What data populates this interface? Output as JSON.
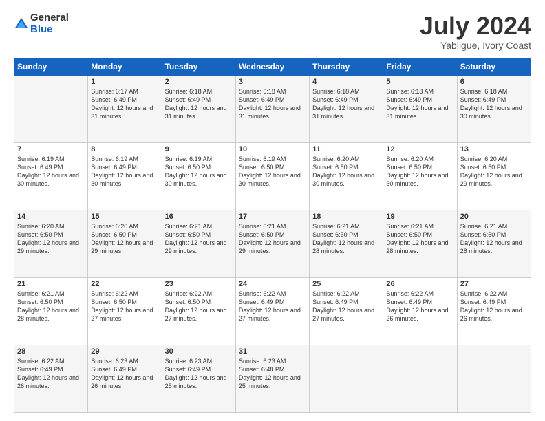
{
  "header": {
    "logo_general": "General",
    "logo_blue": "Blue",
    "title": "July 2024",
    "location": "Yabligue, Ivory Coast"
  },
  "calendar": {
    "days_of_week": [
      "Sunday",
      "Monday",
      "Tuesday",
      "Wednesday",
      "Thursday",
      "Friday",
      "Saturday"
    ],
    "weeks": [
      [
        {
          "day": "",
          "info": ""
        },
        {
          "day": "1",
          "info": "Sunrise: 6:17 AM\nSunset: 6:49 PM\nDaylight: 12 hours and 31 minutes."
        },
        {
          "day": "2",
          "info": "Sunrise: 6:18 AM\nSunset: 6:49 PM\nDaylight: 12 hours and 31 minutes."
        },
        {
          "day": "3",
          "info": "Sunrise: 6:18 AM\nSunset: 6:49 PM\nDaylight: 12 hours and 31 minutes."
        },
        {
          "day": "4",
          "info": "Sunrise: 6:18 AM\nSunset: 6:49 PM\nDaylight: 12 hours and 31 minutes."
        },
        {
          "day": "5",
          "info": "Sunrise: 6:18 AM\nSunset: 6:49 PM\nDaylight: 12 hours and 31 minutes."
        },
        {
          "day": "6",
          "info": "Sunrise: 6:18 AM\nSunset: 6:49 PM\nDaylight: 12 hours and 30 minutes."
        }
      ],
      [
        {
          "day": "7",
          "info": "Sunrise: 6:19 AM\nSunset: 6:49 PM\nDaylight: 12 hours and 30 minutes."
        },
        {
          "day": "8",
          "info": "Sunrise: 6:19 AM\nSunset: 6:49 PM\nDaylight: 12 hours and 30 minutes."
        },
        {
          "day": "9",
          "info": "Sunrise: 6:19 AM\nSunset: 6:50 PM\nDaylight: 12 hours and 30 minutes."
        },
        {
          "day": "10",
          "info": "Sunrise: 6:19 AM\nSunset: 6:50 PM\nDaylight: 12 hours and 30 minutes."
        },
        {
          "day": "11",
          "info": "Sunrise: 6:20 AM\nSunset: 6:50 PM\nDaylight: 12 hours and 30 minutes."
        },
        {
          "day": "12",
          "info": "Sunrise: 6:20 AM\nSunset: 6:50 PM\nDaylight: 12 hours and 30 minutes."
        },
        {
          "day": "13",
          "info": "Sunrise: 6:20 AM\nSunset: 6:50 PM\nDaylight: 12 hours and 29 minutes."
        }
      ],
      [
        {
          "day": "14",
          "info": "Sunrise: 6:20 AM\nSunset: 6:50 PM\nDaylight: 12 hours and 29 minutes."
        },
        {
          "day": "15",
          "info": "Sunrise: 6:20 AM\nSunset: 6:50 PM\nDaylight: 12 hours and 29 minutes."
        },
        {
          "day": "16",
          "info": "Sunrise: 6:21 AM\nSunset: 6:50 PM\nDaylight: 12 hours and 29 minutes."
        },
        {
          "day": "17",
          "info": "Sunrise: 6:21 AM\nSunset: 6:50 PM\nDaylight: 12 hours and 29 minutes."
        },
        {
          "day": "18",
          "info": "Sunrise: 6:21 AM\nSunset: 6:50 PM\nDaylight: 12 hours and 28 minutes."
        },
        {
          "day": "19",
          "info": "Sunrise: 6:21 AM\nSunset: 6:50 PM\nDaylight: 12 hours and 28 minutes."
        },
        {
          "day": "20",
          "info": "Sunrise: 6:21 AM\nSunset: 6:50 PM\nDaylight: 12 hours and 28 minutes."
        }
      ],
      [
        {
          "day": "21",
          "info": "Sunrise: 6:21 AM\nSunset: 6:50 PM\nDaylight: 12 hours and 28 minutes."
        },
        {
          "day": "22",
          "info": "Sunrise: 6:22 AM\nSunset: 6:50 PM\nDaylight: 12 hours and 27 minutes."
        },
        {
          "day": "23",
          "info": "Sunrise: 6:22 AM\nSunset: 6:50 PM\nDaylight: 12 hours and 27 minutes."
        },
        {
          "day": "24",
          "info": "Sunrise: 6:22 AM\nSunset: 6:49 PM\nDaylight: 12 hours and 27 minutes."
        },
        {
          "day": "25",
          "info": "Sunrise: 6:22 AM\nSunset: 6:49 PM\nDaylight: 12 hours and 27 minutes."
        },
        {
          "day": "26",
          "info": "Sunrise: 6:22 AM\nSunset: 6:49 PM\nDaylight: 12 hours and 26 minutes."
        },
        {
          "day": "27",
          "info": "Sunrise: 6:22 AM\nSunset: 6:49 PM\nDaylight: 12 hours and 26 minutes."
        }
      ],
      [
        {
          "day": "28",
          "info": "Sunrise: 6:22 AM\nSunset: 6:49 PM\nDaylight: 12 hours and 26 minutes."
        },
        {
          "day": "29",
          "info": "Sunrise: 6:23 AM\nSunset: 6:49 PM\nDaylight: 12 hours and 26 minutes."
        },
        {
          "day": "30",
          "info": "Sunrise: 6:23 AM\nSunset: 6:49 PM\nDaylight: 12 hours and 25 minutes."
        },
        {
          "day": "31",
          "info": "Sunrise: 6:23 AM\nSunset: 6:48 PM\nDaylight: 12 hours and 25 minutes."
        },
        {
          "day": "",
          "info": ""
        },
        {
          "day": "",
          "info": ""
        },
        {
          "day": "",
          "info": ""
        }
      ]
    ]
  }
}
